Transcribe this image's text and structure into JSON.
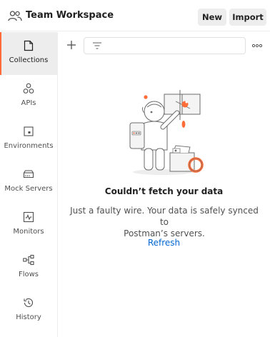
{
  "header": {
    "workspace_icon": "team-icon",
    "title": "Team Workspace",
    "new_label": "New",
    "import_label": "Import"
  },
  "sidebar": {
    "items": [
      {
        "label": "Collections",
        "icon": "collections-icon",
        "active": true
      },
      {
        "label": "APIs",
        "icon": "apis-icon",
        "active": false
      },
      {
        "label": "Environments",
        "icon": "environments-icon",
        "active": false
      },
      {
        "label": "Mock Servers",
        "icon": "mock-servers-icon",
        "active": false
      },
      {
        "label": "Monitors",
        "icon": "monitors-icon",
        "active": false
      },
      {
        "label": "Flows",
        "icon": "flows-icon",
        "active": false
      },
      {
        "label": "History",
        "icon": "history-icon",
        "active": false
      }
    ]
  },
  "toolbar": {
    "add_icon": "plus-icon",
    "filter_icon": "filter-icon",
    "filter_value": "",
    "more_icon": "more-horizontal-icon"
  },
  "empty_state": {
    "illustration": "astronaut-repairing-wire",
    "title": "Couldn’t fetch your data",
    "text_line1": "Just a faulty wire. Your data is safely synced to",
    "text_line2": "Postman’s servers.",
    "refresh_label": "Refresh"
  },
  "colors": {
    "accent": "#ff6c37",
    "link": "#0265d2",
    "active_bg": "#ededed"
  }
}
